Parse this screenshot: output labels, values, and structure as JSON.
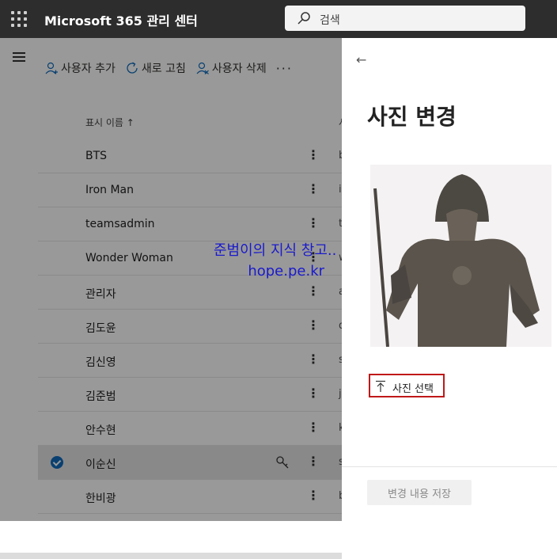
{
  "header": {
    "app_title": "Microsoft 365 관리 센터",
    "search_placeholder": "검색"
  },
  "toolbar": {
    "add_user": "사용자 추가",
    "refresh": "새로 고침",
    "delete_user": "사용자 삭제",
    "more": "···"
  },
  "table": {
    "column_display_name": "표시 이름 ↑",
    "column_second": "사",
    "rows": [
      {
        "name": "BTS",
        "c2": "b"
      },
      {
        "name": "Iron Man",
        "c2": "i"
      },
      {
        "name": "teamsadmin",
        "c2": "t"
      },
      {
        "name": "Wonder Woman",
        "c2": "w"
      },
      {
        "name": "관리자",
        "c2": "a"
      },
      {
        "name": "김도윤",
        "c2": "d"
      },
      {
        "name": "김신영",
        "c2": "s"
      },
      {
        "name": "김준범",
        "c2": "j"
      },
      {
        "name": "안수현",
        "c2": "k"
      },
      {
        "name": "이순신",
        "c2": "s",
        "selected": true
      },
      {
        "name": "한비광",
        "c2": "b"
      }
    ]
  },
  "watermark": {
    "line1": "준범이의 지식 창고..",
    "line2": "hope.pe.kr"
  },
  "panel": {
    "back": "←",
    "title": "사진 변경",
    "choose_photo": "사진 선택",
    "save": "변경 내용 저장"
  },
  "colors": {
    "accent": "#0f6cbd",
    "highlight_border": "#c01818",
    "topbar": "#2d2d2d"
  }
}
